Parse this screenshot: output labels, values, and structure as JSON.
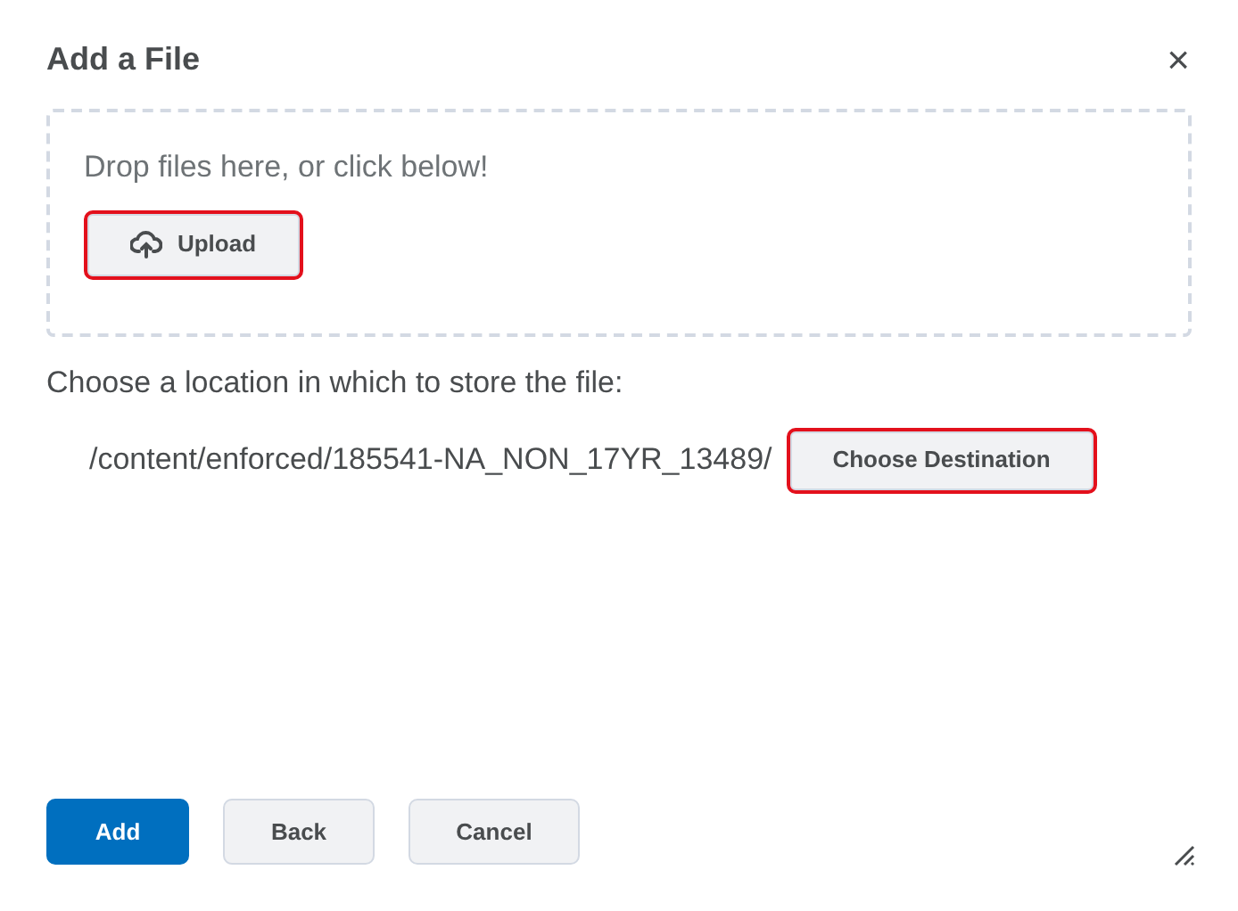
{
  "dialog": {
    "title": "Add a File",
    "close": "×"
  },
  "dropzone": {
    "prompt": "Drop files here, or click below!",
    "upload_button": {
      "label": "Upload",
      "highlighted": true
    }
  },
  "location": {
    "label": "Choose a location in which to store the file:",
    "path": "/content/enforced/185541-NA_NON_17YR_13489/",
    "choose_button": {
      "label": "Choose Destination",
      "highlighted": true
    }
  },
  "footer_buttons": [
    {
      "label": "Add",
      "kind": "primary"
    },
    {
      "label": "Back",
      "kind": "secondary"
    },
    {
      "label": "Cancel",
      "kind": "secondary"
    }
  ]
}
